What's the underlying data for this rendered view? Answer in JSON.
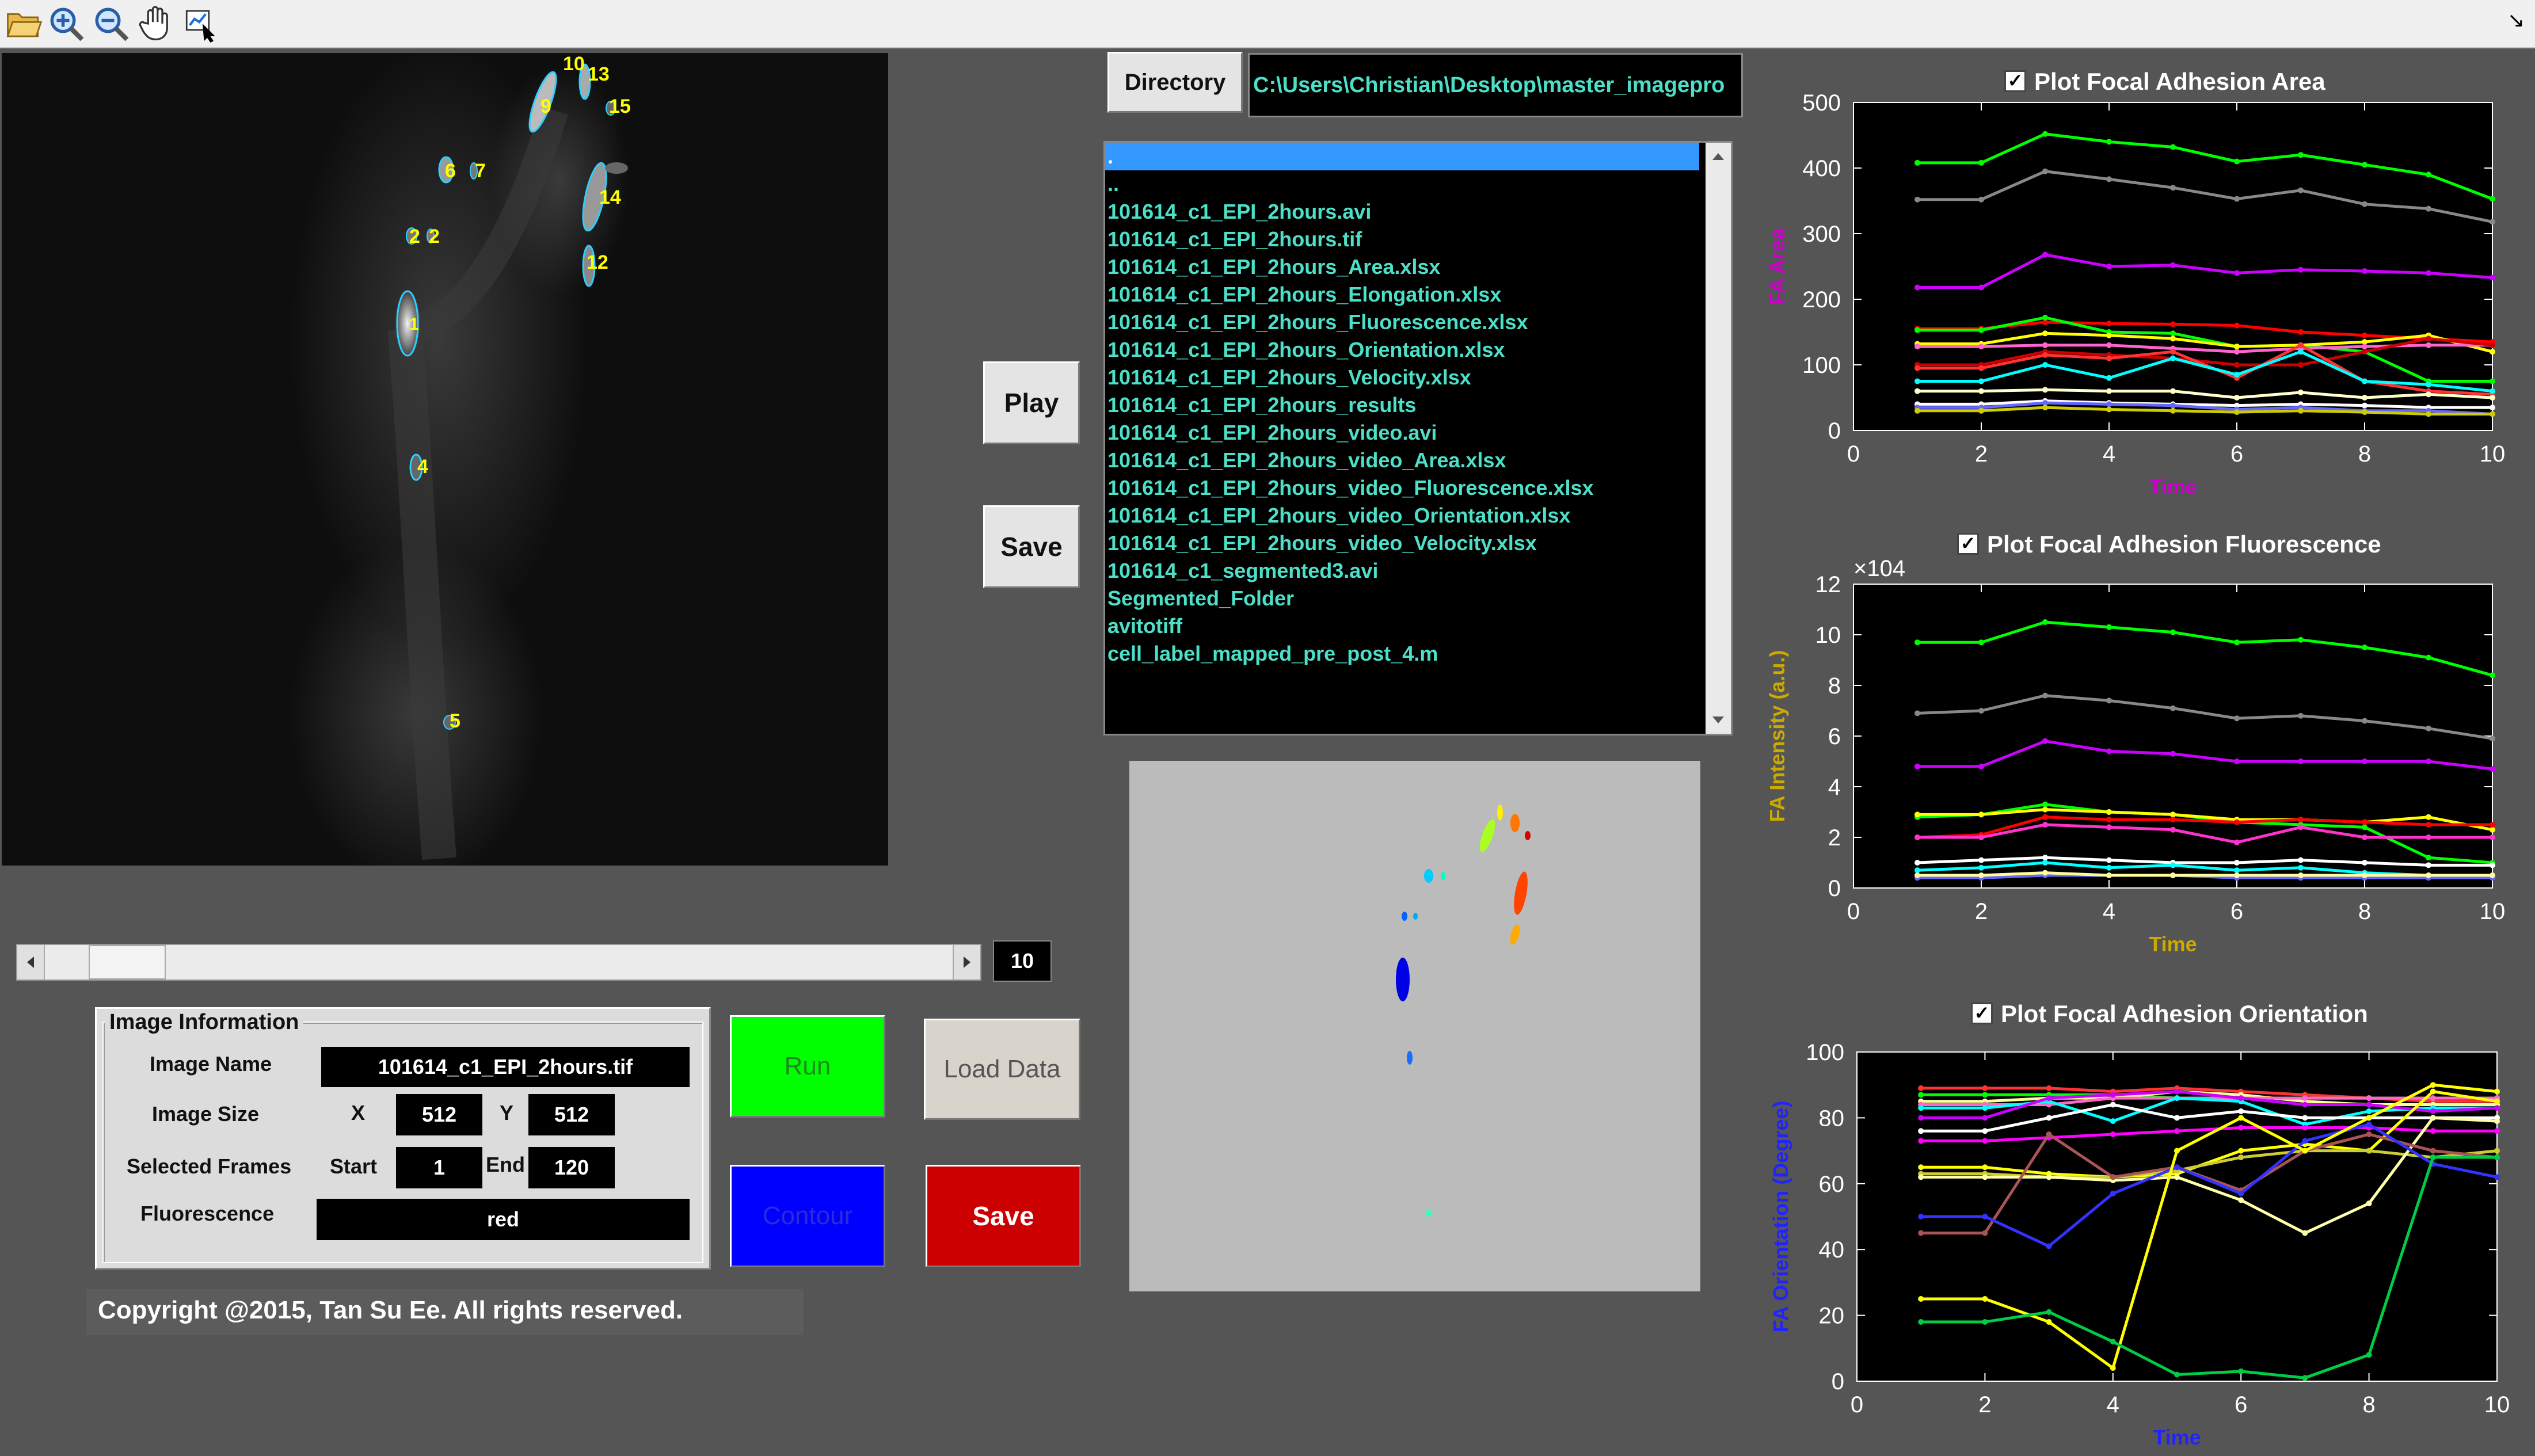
{
  "toolbar": {
    "icons": [
      "open-folder-icon",
      "zoom-in-icon",
      "zoom-out-icon",
      "pan-hand-icon",
      "data-cursor-icon"
    ],
    "corner": "↘"
  },
  "micro_labels": [
    "10",
    "13",
    "9",
    "15",
    "6",
    "7",
    "14",
    "2",
    "2",
    "12",
    "1",
    "4",
    "5"
  ],
  "slider": {
    "value": "10"
  },
  "directory": {
    "button": "Directory",
    "path": "C:\\Users\\Christian\\Desktop\\master_imagepro"
  },
  "files": [
    ".",
    "..",
    "101614_c1_EPI_2hours.avi",
    "101614_c1_EPI_2hours.tif",
    "101614_c1_EPI_2hours_Area.xlsx",
    "101614_c1_EPI_2hours_Elongation.xlsx",
    "101614_c1_EPI_2hours_Fluorescence.xlsx",
    "101614_c1_EPI_2hours_Orientation.xlsx",
    "101614_c1_EPI_2hours_Velocity.xlsx",
    "101614_c1_EPI_2hours_results",
    "101614_c1_EPI_2hours_video.avi",
    "101614_c1_EPI_2hours_video_Area.xlsx",
    "101614_c1_EPI_2hours_video_Fluorescence.xlsx",
    "101614_c1_EPI_2hours_video_Orientation.xlsx",
    "101614_c1_EPI_2hours_video_Velocity.xlsx",
    "101614_c1_segmented3.avi",
    "Segmented_Folder",
    "avitotiff",
    "cell_label_mapped_pre_post_4.m"
  ],
  "buttons": {
    "play": "Play",
    "save_mid": "Save",
    "run": "Run",
    "load": "Load Data",
    "contour": "Contour",
    "save": "Save"
  },
  "colors": {
    "run": "#00ff00",
    "contour": "#0000ff",
    "save": "#cc0000",
    "load": "#d8d4cc",
    "selection": "#3399ff",
    "file_text": "#4de0c8"
  },
  "image_info": {
    "title": "Image Information",
    "name_label": "Image Name",
    "name_value": "101614_c1_EPI_2hours.tif",
    "size_label": "Image Size",
    "x_label": "X",
    "x_value": "512",
    "y_label": "Y",
    "y_value": "512",
    "frames_label": "Selected Frames",
    "start_label": "Start",
    "start_value": "1",
    "end_label": "End",
    "end_value": "120",
    "fluor_label": "Fluorescence",
    "fluor_value": "red"
  },
  "copyright": "Copyright @2015, Tan Su Ee. All rights reserved.",
  "chart_data": [
    {
      "type": "line",
      "title": "Plot Focal Adhesion Area",
      "checked": true,
      "xlabel": "Time",
      "ylabel": "FA Area",
      "xlim": [
        0,
        10
      ],
      "ylim": [
        0,
        500
      ],
      "xticks": [
        0,
        2,
        4,
        6,
        8,
        10
      ],
      "yticks": [
        0,
        100,
        200,
        300,
        400,
        500
      ],
      "x": [
        1,
        2,
        3,
        4,
        5,
        6,
        7,
        8,
        9,
        10
      ],
      "series": [
        {
          "color": "#00ff00",
          "values": [
            408,
            408,
            452,
            440,
            432,
            410,
            420,
            405,
            390,
            353
          ]
        },
        {
          "color": "#888888",
          "values": [
            352,
            352,
            395,
            383,
            370,
            353,
            366,
            345,
            338,
            318
          ]
        },
        {
          "color": "#cc00ff",
          "values": [
            218,
            218,
            268,
            250,
            252,
            240,
            245,
            243,
            240,
            233
          ]
        },
        {
          "color": "#ff0000",
          "values": [
            155,
            155,
            165,
            163,
            162,
            160,
            150,
            145,
            140,
            135
          ]
        },
        {
          "color": "#00ff00",
          "values": [
            153,
            153,
            172,
            150,
            148,
            128,
            130,
            120,
            75,
            75
          ]
        },
        {
          "color": "#ffff00",
          "values": [
            132,
            132,
            148,
            145,
            140,
            128,
            130,
            135,
            145,
            120
          ]
        },
        {
          "color": "#ff66cc",
          "values": [
            128,
            128,
            130,
            130,
            125,
            120,
            125,
            128,
            130,
            130
          ]
        },
        {
          "color": "#cc0000",
          "values": [
            100,
            100,
            120,
            115,
            110,
            100,
            100,
            120,
            140,
            130
          ]
        },
        {
          "color": "#ff3333",
          "values": [
            95,
            95,
            115,
            110,
            120,
            80,
            130,
            75,
            60,
            55
          ]
        },
        {
          "color": "#00ffff",
          "values": [
            75,
            75,
            100,
            80,
            110,
            85,
            120,
            75,
            70,
            60
          ]
        },
        {
          "color": "#ffffcc",
          "values": [
            60,
            60,
            62,
            60,
            60,
            50,
            58,
            50,
            55,
            50
          ]
        },
        {
          "color": "#ffffff",
          "values": [
            40,
            40,
            45,
            42,
            40,
            38,
            40,
            38,
            35,
            35
          ]
        },
        {
          "color": "#6666ff",
          "values": [
            35,
            35,
            42,
            40,
            38,
            32,
            35,
            30,
            30,
            25
          ]
        },
        {
          "color": "#cccc00",
          "values": [
            30,
            30,
            35,
            32,
            30,
            28,
            30,
            28,
            25,
            25
          ]
        }
      ]
    },
    {
      "type": "line",
      "title": "Plot Focal Adhesion Fluorescence",
      "checked": true,
      "xlabel": "Time",
      "ylabel": "FA Intensity (a.u.)",
      "exponent": "×10^4",
      "xlim": [
        0,
        10
      ],
      "ylim": [
        0,
        12
      ],
      "xticks": [
        0,
        2,
        4,
        6,
        8,
        10
      ],
      "yticks": [
        0,
        2,
        4,
        6,
        8,
        10,
        12
      ],
      "x": [
        1,
        2,
        3,
        4,
        5,
        6,
        7,
        8,
        9,
        10
      ],
      "series": [
        {
          "color": "#00ff00",
          "values": [
            9.7,
            9.7,
            10.5,
            10.3,
            10.1,
            9.7,
            9.8,
            9.5,
            9.1,
            8.4
          ]
        },
        {
          "color": "#888888",
          "values": [
            6.9,
            7.0,
            7.6,
            7.4,
            7.1,
            6.7,
            6.8,
            6.6,
            6.3,
            5.9
          ]
        },
        {
          "color": "#cc00ff",
          "values": [
            4.8,
            4.8,
            5.8,
            5.4,
            5.3,
            5.0,
            5.0,
            5.0,
            5.0,
            4.7
          ]
        },
        {
          "color": "#00ff00",
          "values": [
            2.8,
            2.9,
            3.3,
            3.0,
            2.9,
            2.6,
            2.5,
            2.4,
            1.2,
            1.0
          ]
        },
        {
          "color": "#ffff00",
          "values": [
            2.9,
            2.9,
            3.1,
            3.0,
            2.9,
            2.7,
            2.7,
            2.6,
            2.8,
            2.3
          ]
        },
        {
          "color": "#ff0000",
          "values": [
            2.0,
            2.1,
            2.8,
            2.7,
            2.7,
            2.6,
            2.7,
            2.6,
            2.5,
            2.5
          ]
        },
        {
          "color": "#ff33cc",
          "values": [
            2.0,
            2.0,
            2.5,
            2.4,
            2.3,
            1.8,
            2.4,
            2.0,
            2.0,
            2.0
          ]
        },
        {
          "color": "#ffffff",
          "values": [
            1.0,
            1.1,
            1.2,
            1.1,
            1.0,
            1.0,
            1.1,
            1.0,
            0.9,
            0.9
          ]
        },
        {
          "color": "#00ffff",
          "values": [
            0.7,
            0.8,
            1.0,
            0.8,
            0.9,
            0.7,
            0.8,
            0.6,
            0.5,
            0.5
          ]
        },
        {
          "color": "#6666ff",
          "values": [
            0.4,
            0.4,
            0.5,
            0.5,
            0.5,
            0.4,
            0.4,
            0.4,
            0.4,
            0.4
          ]
        },
        {
          "color": "#ffff99",
          "values": [
            0.5,
            0.5,
            0.6,
            0.5,
            0.5,
            0.5,
            0.5,
            0.5,
            0.5,
            0.5
          ]
        }
      ]
    },
    {
      "type": "line",
      "title": "Plot Focal Adhesion Orientation",
      "checked": true,
      "xlabel": "Time",
      "ylabel": "FA Orientation (Degree)",
      "xlim": [
        0,
        10
      ],
      "ylim": [
        0,
        100
      ],
      "xticks": [
        0,
        2,
        4,
        6,
        8,
        10
      ],
      "yticks": [
        0,
        20,
        40,
        60,
        80,
        100
      ],
      "x": [
        1,
        2,
        3,
        4,
        5,
        6,
        7,
        8,
        9,
        10
      ],
      "series": [
        {
          "color": "#ff3333",
          "values": [
            89,
            89,
            89,
            88,
            89,
            88,
            87,
            86,
            85,
            85
          ]
        },
        {
          "color": "#00ff00",
          "values": [
            87,
            87,
            87,
            87,
            86,
            86,
            86,
            86,
            86,
            86
          ]
        },
        {
          "color": "#ffff99",
          "values": [
            85,
            85,
            86,
            86,
            88,
            87,
            85,
            84,
            84,
            84
          ]
        },
        {
          "color": "#ff66cc",
          "values": [
            84,
            84,
            84,
            86,
            86,
            86,
            86,
            86,
            86,
            86
          ]
        },
        {
          "color": "#00ffff",
          "values": [
            83,
            83,
            85,
            79,
            86,
            85,
            78,
            82,
            83,
            83
          ]
        },
        {
          "color": "#cc00ff",
          "values": [
            80,
            80,
            86,
            87,
            88,
            86,
            84,
            84,
            82,
            83
          ]
        },
        {
          "color": "#ffffff",
          "values": [
            76,
            76,
            80,
            84,
            80,
            82,
            80,
            80,
            80,
            80
          ]
        },
        {
          "color": "#ff00ff",
          "values": [
            73,
            73,
            74,
            75,
            76,
            77,
            77,
            77,
            76,
            76
          ]
        },
        {
          "color": "#ffff00",
          "values": [
            65,
            65,
            63,
            62,
            63,
            70,
            72,
            70,
            88,
            85
          ]
        },
        {
          "color": "#cccc33",
          "values": [
            63,
            63,
            62,
            62,
            64,
            68,
            70,
            70,
            68,
            70
          ]
        },
        {
          "color": "#ffffaa",
          "values": [
            62,
            62,
            62,
            61,
            62,
            55,
            45,
            54,
            80,
            79
          ]
        },
        {
          "color": "#aa5555",
          "values": [
            45,
            45,
            75,
            62,
            65,
            58,
            70,
            75,
            70,
            68
          ]
        },
        {
          "color": "#3333ff",
          "values": [
            50,
            50,
            41,
            57,
            65,
            57,
            73,
            78,
            66,
            62
          ]
        },
        {
          "color": "#ffff00",
          "values": [
            25,
            25,
            18,
            4,
            70,
            80,
            70,
            80,
            90,
            88
          ]
        },
        {
          "color": "#00cc44",
          "values": [
            18,
            18,
            21,
            12,
            2,
            3,
            1,
            8,
            68,
            68
          ]
        }
      ]
    }
  ]
}
